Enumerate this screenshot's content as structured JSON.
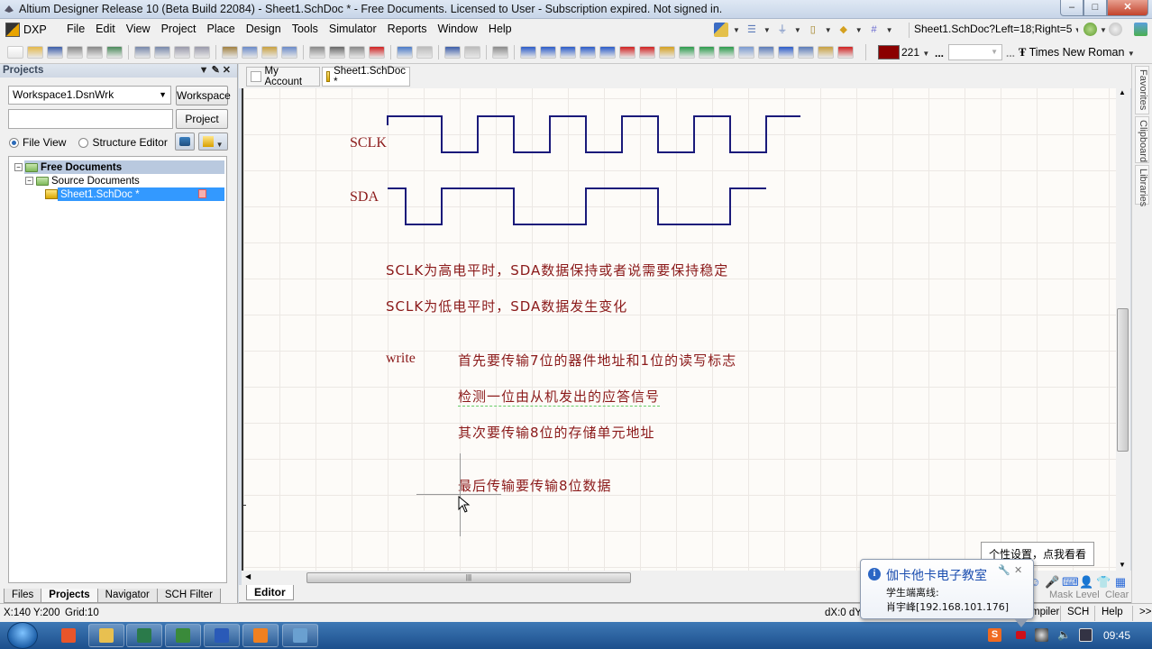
{
  "window": {
    "title": "Altium Designer Release 10 (Beta Build 22084) - Sheet1.SchDoc * - Free Documents. Licensed to User - Subscription expired. Not signed in.",
    "controls": {
      "minimize": "–",
      "maximize": "□",
      "close": "✕"
    }
  },
  "menubar": {
    "dxp": "DXP",
    "items": [
      "File",
      "Edit",
      "View",
      "Project",
      "Place",
      "Design",
      "Tools",
      "Simulator",
      "Reports",
      "Window",
      "Help"
    ]
  },
  "toolbar": {
    "address": "Sheet1.SchDoc?Left=18;Right=5",
    "color_hex": "#8b0000",
    "color_value": "221",
    "ellipsis": "...",
    "font_name": "Times New Roman",
    "icons_row1_right": [
      "wire-tools-icon",
      "port-icon",
      "ground-icon",
      "part-icon",
      "net-label-icon",
      "grid-icon"
    ],
    "icons_row2": [
      "new-icon",
      "open-icon",
      "save-icon",
      "print-icon",
      "print-preview-icon",
      "board-icon",
      "zoom-fit-icon",
      "zoom-area-icon",
      "zoom-component-icon",
      "zoom-selected-icon",
      "cut-icon",
      "copy-icon",
      "paste-icon",
      "rubber-stamp-icon",
      "select-area-icon",
      "move-icon",
      "deselect-icon",
      "clear-filter-icon",
      "undo-icon",
      "redo-icon",
      "hierarchy-icon",
      "cross-probe-icon",
      "browse-library-icon",
      "place-wire-icon",
      "place-bus-icon",
      "bus-entry-icon",
      "place-net-label-icon",
      "net-icon",
      "gnd-icon",
      "vcc-icon",
      "place-part-icon",
      "sheet-symbol-icon",
      "sheet-entry-icon",
      "device-sheet-icon",
      "harness-icon",
      "harness-connector-icon",
      "harness-entry-icon",
      "port-place-icon",
      "off-sheet-icon",
      "no-erc-icon"
    ]
  },
  "projects_panel": {
    "title": "Projects",
    "workspace_combo": "Workspace1.DsnWrk",
    "workspace_button": "Workspace",
    "project_input": "",
    "project_button": "Project",
    "radio_file_view": "File View",
    "radio_structure_editor": "Structure Editor",
    "selected_view": "File View",
    "tree": {
      "root": "Free Documents",
      "folder": "Source Documents",
      "file": "Sheet1.SchDoc *"
    },
    "tabs": [
      "Files",
      "Projects",
      "Navigator",
      "SCH Filter"
    ],
    "active_tab": "Projects"
  },
  "doc_tabs": [
    {
      "label": "My Account"
    },
    {
      "label": "Sheet1.SchDoc *",
      "active": true
    }
  ],
  "canvas": {
    "signals": [
      {
        "label": "SCLK",
        "levels": [
          1,
          0,
          1,
          0,
          1,
          0,
          1,
          0,
          1,
          0,
          1
        ]
      },
      {
        "label": "SDA",
        "levels": [
          1,
          0,
          1,
          1,
          0,
          0,
          1,
          1,
          0,
          0,
          1
        ]
      }
    ],
    "notes": [
      "SCLK为高电平时，SDA数据保持或者说需要保持稳定",
      "SCLK为低电平时，SDA数据发生变化"
    ],
    "write_label": "write",
    "write_steps": [
      "首先要传输7位的器件地址和1位的读写标志",
      "检测一位由从机发出的应答信号",
      "其次要传输8位的存储单元地址",
      "最后传输要传输8位数据"
    ],
    "wave_color": "#1a1a7a",
    "text_color": "#8b1a1a"
  },
  "side_tabs": [
    "Favorites",
    "Clipboard",
    "Libraries"
  ],
  "editor_tab": "Editor",
  "statusbar": {
    "coords": "X:140 Y:200",
    "grid": "Grid:10",
    "delta": "dX:0 dY",
    "right_tabs": [
      "mpiler",
      "SCH",
      "Help",
      ">>"
    ],
    "mask_level": "Mask Level",
    "clear": "Clear"
  },
  "tooltip_small": "个性设置，点我看看",
  "notification": {
    "title": "伽卡他卡电子教室",
    "line1": "学生端离线:",
    "line2": "肖宇峰[192.168.101.176]"
  },
  "taskbar": {
    "apps": [
      "uc-browser-icon",
      "explorer-icon",
      "altium-icon",
      "terminal-icon",
      "word-icon",
      "orange-app-icon",
      "paint-icon"
    ],
    "clock": "09:45"
  }
}
